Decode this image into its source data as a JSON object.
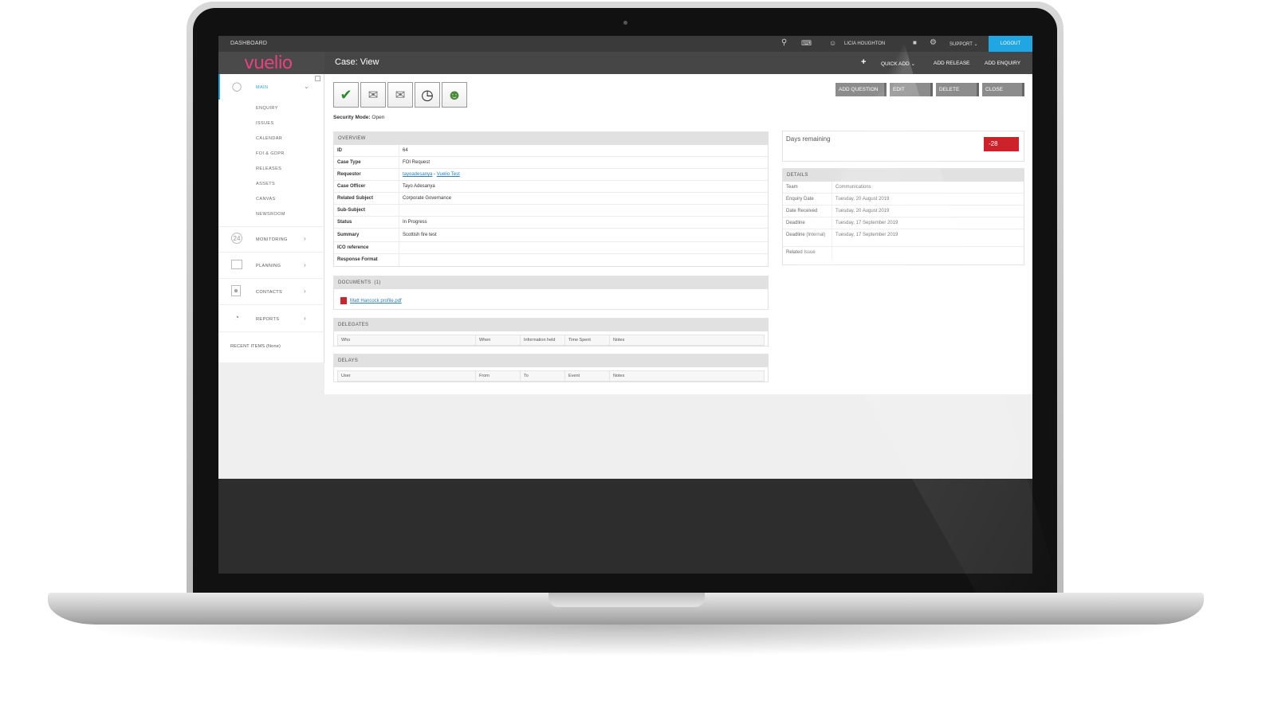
{
  "topbar": {
    "dashboard": "DASHBOARD",
    "user_name": "LICIA HOUGHTON",
    "support_label": "SUPPORT",
    "logout_label": "LOGOUT"
  },
  "header": {
    "logo": "vuelio",
    "page_title": "Case:  View",
    "quick_add": "QUICK ADD",
    "add_release": "ADD RELEASE",
    "add_enquiry": "ADD ENQUIRY"
  },
  "sidebar": {
    "main_label": "MAIN",
    "main_items": [
      "ENQUIRY",
      "ISSUES",
      "CALENDAR",
      "FOI & GDPR",
      "RELEASES",
      "ASSETS",
      "CANVAS",
      "NEWSROOM"
    ],
    "sections": [
      "MONITORING",
      "PLANNING",
      "CONTACTS",
      "REPORTS"
    ],
    "recent_items": "RECENT ITEMS (None)"
  },
  "toolbar": {
    "security_mode_label": "Security Mode:",
    "security_mode_value": "Open",
    "buttons": [
      "ADD QUESTION",
      "EDIT",
      "DELETE",
      "CLOSE"
    ]
  },
  "overview": {
    "title": "OVERVIEW",
    "rows": [
      {
        "k": "ID",
        "v": "64"
      },
      {
        "k": "Case Type",
        "v": "FOI Request"
      },
      {
        "k": "Requestor",
        "v": ""
      },
      {
        "k": "Case Officer",
        "v": "Tayo Adesanya"
      },
      {
        "k": "Related Subject",
        "v": "Corporate Governance"
      },
      {
        "k": "Sub-Subject",
        "v": ""
      },
      {
        "k": "Status",
        "v": "In Progress"
      },
      {
        "k": "Summary",
        "v": "Scottish fire test"
      },
      {
        "k": "ICO reference",
        "v": ""
      },
      {
        "k": "Response Format",
        "v": ""
      }
    ],
    "requestor_link1": "tayoadesanya",
    "requestor_sep": " - ",
    "requestor_link2": "Vuelio Test"
  },
  "documents": {
    "title": "DOCUMENTS",
    "count": "(1)",
    "file": "Matt Hancock profile.pdf"
  },
  "delegates": {
    "title": "DELEGATES",
    "cols": [
      "Who",
      "When",
      "Information held",
      "Time Spent",
      "Notes"
    ]
  },
  "delays": {
    "title": "DELAYS",
    "cols": [
      "User",
      "From",
      "To",
      "Event",
      "Notes"
    ]
  },
  "days": {
    "label": "Days remaining",
    "value": "-28"
  },
  "details": {
    "title": "DETAILS",
    "rows": [
      {
        "k": "Team",
        "v": "Communications"
      },
      {
        "k": "Enquiry Date",
        "v": "Tuesday, 20 August 2019"
      },
      {
        "k": "Date Received",
        "v": "Tuesday, 20 August 2019"
      },
      {
        "k": "Deadline",
        "v": "Tuesday, 17 September 2019"
      },
      {
        "k": "Deadline (Internal)",
        "v": "Tuesday, 17 September 2019"
      },
      {
        "k": "Related Issue",
        "v": ""
      }
    ]
  },
  "colors": {
    "accent": "#20a7e3",
    "brand": "#e8417f",
    "badge": "#cc2229"
  }
}
